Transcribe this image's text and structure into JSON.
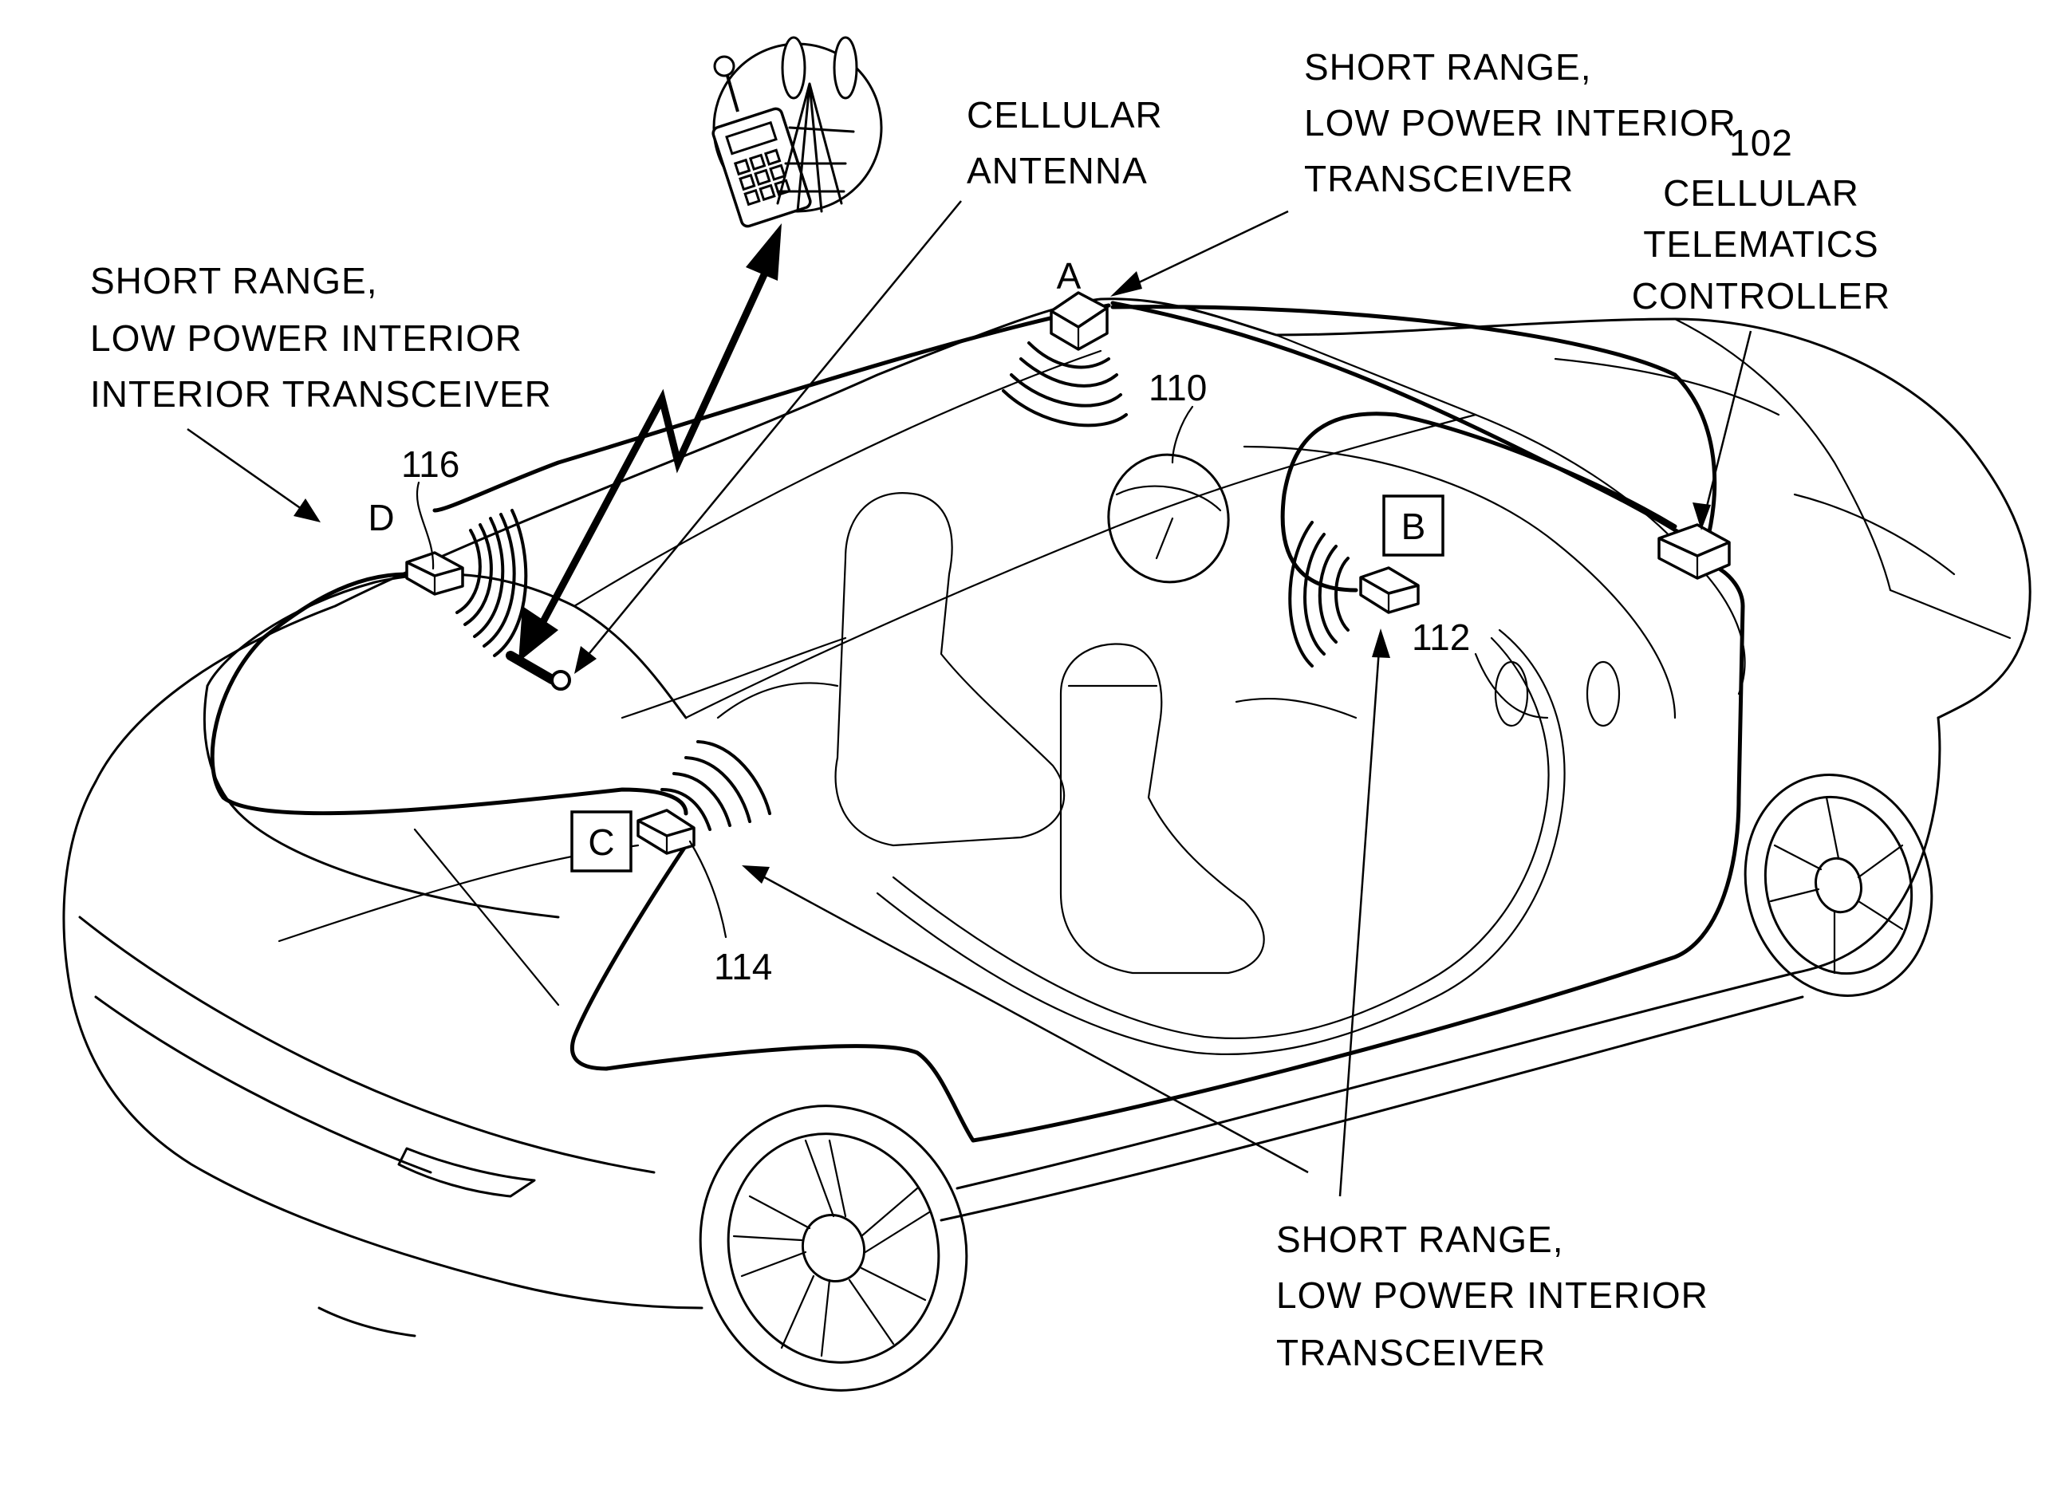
{
  "figure": {
    "title": "Vehicle with cellular telematics controller and short range low power interior transceivers",
    "labels": {
      "cellular_antenna": [
        "CELLULAR",
        "ANTENNA"
      ],
      "transceiver_a": [
        "SHORT RANGE,",
        "LOW POWER INTERIOR",
        "TRANSCEIVER"
      ],
      "transceiver_d": [
        "SHORT RANGE,",
        "LOW POWER INTERIOR",
        "INTERIOR TRANSCEIVER"
      ],
      "controller": [
        "102",
        "CELLULAR",
        "TELEMATICS",
        "CONTROLLER"
      ],
      "transceiver_bc": [
        "SHORT RANGE,",
        "LOW POWER INTERIOR",
        "TRANSCEIVER"
      ]
    },
    "position_letters": {
      "a": "A",
      "b": "B",
      "c": "C",
      "d": "D"
    },
    "reference_numerals": {
      "roof_module": "110",
      "b_module": "112",
      "c_module": "114",
      "d_module": "116"
    },
    "icons": {
      "cellular_network": "phone-and-tower-icon",
      "wireless_link": "lightning-bolt-double-arrow-icon",
      "antenna": "cellular-antenna-icon"
    }
  }
}
